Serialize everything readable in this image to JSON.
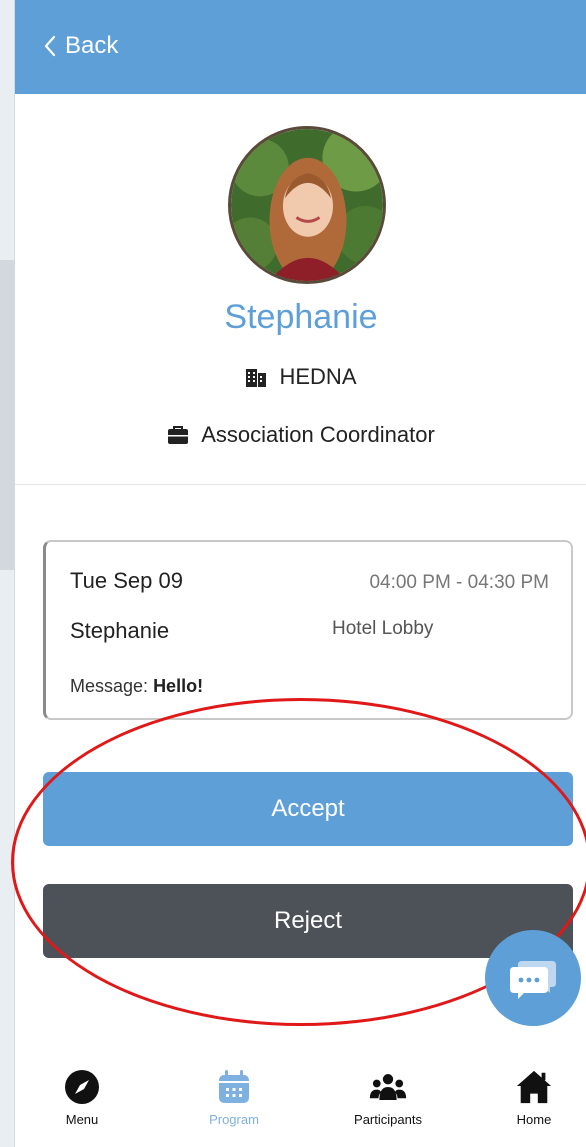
{
  "header": {
    "back_label": "Back"
  },
  "profile": {
    "name": "Stephanie",
    "organization": "HEDNA",
    "title": "Association Coordinator"
  },
  "meeting": {
    "date": "Tue Sep 09",
    "time": "04:00 PM - 04:30 PM",
    "with": "Stephanie",
    "location": "Hotel Lobby",
    "message_label": "Message:",
    "message_text": "Hello!"
  },
  "actions": {
    "accept_label": "Accept",
    "reject_label": "Reject"
  },
  "tabs": [
    {
      "label": "Menu",
      "icon": "compass-icon",
      "active": false
    },
    {
      "label": "Program",
      "icon": "calendar-icon",
      "active": true
    },
    {
      "label": "Participants",
      "icon": "people-icon",
      "active": false
    },
    {
      "label": "Home",
      "icon": "home-icon",
      "active": false
    }
  ],
  "colors": {
    "accent": "#5e9fd8",
    "reject": "#4c5257",
    "highlight": "#e01818"
  }
}
